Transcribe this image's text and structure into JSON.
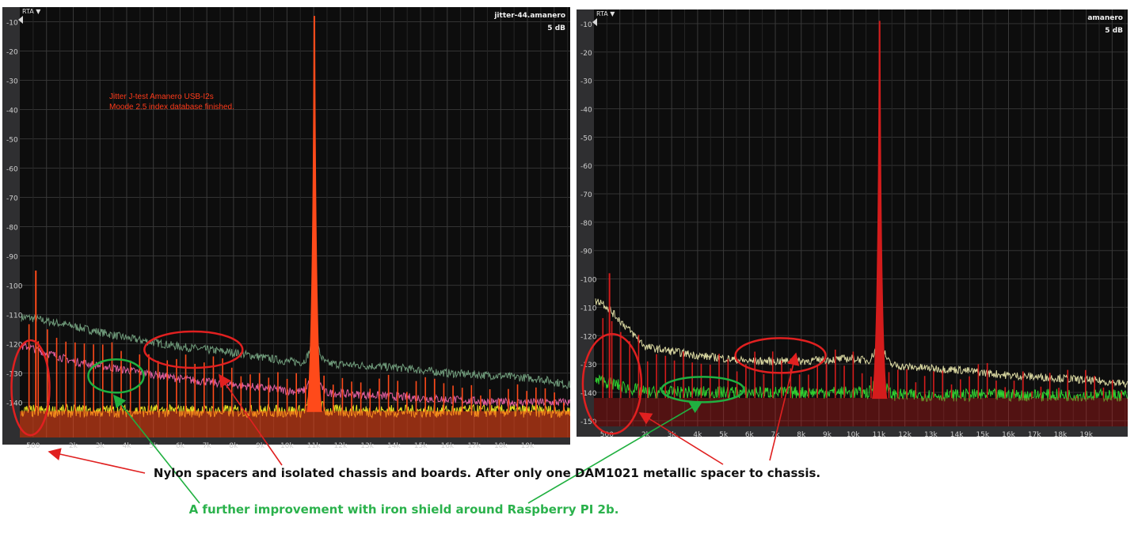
{
  "chart_data": [
    {
      "type": "line",
      "label": "RTA ▼",
      "title": "jitter-44.amanero",
      "subtitle": "5 dB",
      "annotation": [
        "Jitter J-test Amanero USB-I2s",
        "Moode 2.5 index database finished."
      ],
      "ylim": [
        -152,
        -5
      ],
      "xlim": [
        0,
        20600
      ],
      "y_ticks": [
        -10,
        -20,
        -30,
        -40,
        -50,
        -60,
        -70,
        -80,
        -90,
        -100,
        -110,
        -120,
        -130,
        -140
      ],
      "y_tick_labels": [
        "-10",
        "-20",
        "-30",
        "-40",
        "-50",
        "-60",
        "-70",
        "-80",
        "-90",
        "-100",
        "-110",
        "-120",
        "-130",
        "-140"
      ],
      "x_ticks": [
        500,
        2000,
        3000,
        4000,
        5000,
        6000,
        7000,
        8000,
        9000,
        10000,
        11000,
        12000,
        13000,
        14000,
        15000,
        16000,
        17000,
        18000,
        19000
      ],
      "x_tick_labels": [
        "500",
        "2k",
        "3k",
        "4k",
        "5k",
        "6k",
        "7k",
        "8k",
        "9k",
        "10k",
        "11k",
        "12k",
        "13k",
        "14k",
        "15k",
        "16k",
        "17k",
        "18k",
        "19k"
      ],
      "grid": true,
      "series": [
        {
          "color": "#6f9a7a",
          "values": [
            -111,
            -114,
            -118,
            -121,
            -123,
            -126,
            -127,
            -128,
            -130,
            -131,
            -132,
            -134
          ]
        },
        {
          "color": "#e060a0",
          "values": [
            -121,
            -126,
            -129,
            -132,
            -134,
            -136,
            -137,
            -138,
            -139,
            -140,
            -140,
            -140
          ]
        },
        {
          "color": "#e8e020",
          "values": [
            -143,
            -143,
            -143,
            -143,
            -143,
            -143,
            -143,
            -143,
            -143,
            -143,
            -143,
            -143
          ]
        }
      ],
      "x_series": [
        300,
        2000,
        4000,
        6000,
        8000,
        10000,
        12000,
        14000,
        16000,
        18000,
        19500,
        20500
      ],
      "peak": {
        "x": 11025,
        "y": -8
      },
      "highlights": [
        {
          "color": "#e02020",
          "x": 400,
          "y": -135
        },
        {
          "color": "#20b040",
          "x": 3600,
          "y": -131
        },
        {
          "color": "#e02020",
          "x": 6500,
          "y": -122
        }
      ]
    },
    {
      "type": "line",
      "label": "RTA ▼",
      "title": "amanero",
      "subtitle": "5 dB",
      "ylim": [
        -152,
        -5
      ],
      "xlim": [
        0,
        20600
      ],
      "y_ticks": [
        -10,
        -20,
        -30,
        -40,
        -50,
        -60,
        -70,
        -80,
        -90,
        -100,
        -110,
        -120,
        -130,
        -140,
        -150
      ],
      "y_tick_labels": [
        "-10",
        "-20",
        "-30",
        "-40",
        "-50",
        "-60",
        "-70",
        "-80",
        "-90",
        "-100",
        "-110",
        "-120",
        "-130",
        "-140",
        "-150"
      ],
      "x_ticks": [
        500,
        2000,
        3000,
        4000,
        5000,
        6000,
        7000,
        8000,
        9000,
        10000,
        11000,
        12000,
        13000,
        14000,
        15000,
        16000,
        17000,
        18000,
        19000
      ],
      "x_tick_labels": [
        "500",
        "2k",
        "3k",
        "4k",
        "5k",
        "6k",
        "7k",
        "8k",
        "9k",
        "10k",
        "11k",
        "12k",
        "13k",
        "14k",
        "15k",
        "16k",
        "17k",
        "18k",
        "19k"
      ],
      "grid": true,
      "series": [
        {
          "color": "#d8d6a0",
          "values": [
            -108,
            -124,
            -127,
            -129,
            -129,
            -128,
            -131,
            -132,
            -134,
            -135,
            -136,
            -137
          ]
        },
        {
          "color": "#30d030",
          "values": [
            -136,
            -140,
            -140,
            -140,
            -140,
            -140,
            -141,
            -141,
            -141,
            -141,
            -141,
            -141
          ]
        }
      ],
      "x_series": [
        300,
        2000,
        4000,
        6000,
        8000,
        10000,
        12000,
        14000,
        16000,
        18000,
        19500,
        20500
      ],
      "peak": {
        "x": 11025,
        "y": -9
      },
      "highlights": [
        {
          "color": "#e02020",
          "x": 700,
          "y": -137
        },
        {
          "color": "#20b040",
          "x": 4200,
          "y": -139
        },
        {
          "color": "#e02020",
          "x": 7200,
          "y": -127
        }
      ]
    }
  ],
  "captions": {
    "line1": "Nylon spacers and isolated chassis and boards. After  only one DAM1021 metallic spacer to chassis.",
    "line2": "A further improvement with iron shield around Raspberry PI 2b."
  }
}
